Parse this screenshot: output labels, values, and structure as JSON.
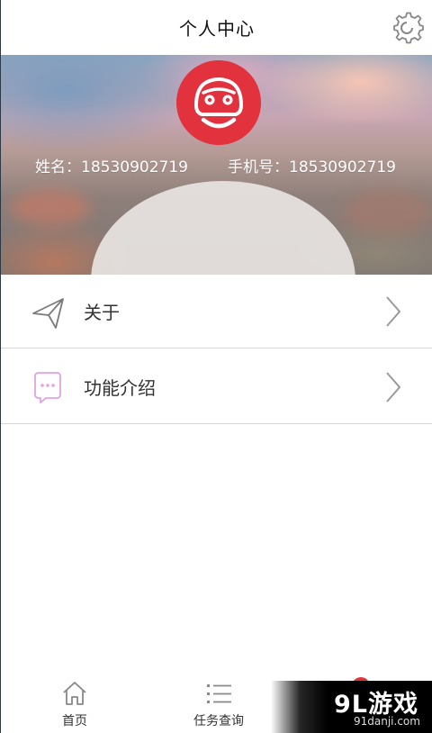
{
  "header": {
    "title": "个人中心",
    "settings_icon": "gear-icon"
  },
  "profile": {
    "name_label": "姓名：18530902719",
    "phone_label": "手机号：18530902719",
    "avatar_icon": "car-face-logo-icon",
    "avatar_color": "#e1323e"
  },
  "menu": {
    "items": [
      {
        "label": "关于",
        "icon": "send-arrow-icon"
      },
      {
        "label": "功能介绍",
        "icon": "chat-bubble-icon"
      }
    ]
  },
  "bottom_nav": {
    "tabs": [
      {
        "label": "首页",
        "icon": "home-icon"
      },
      {
        "label": "任务查询",
        "icon": "list-icon"
      }
    ]
  },
  "watermark": {
    "brand": "9L游戏",
    "site": "91danji.com"
  }
}
